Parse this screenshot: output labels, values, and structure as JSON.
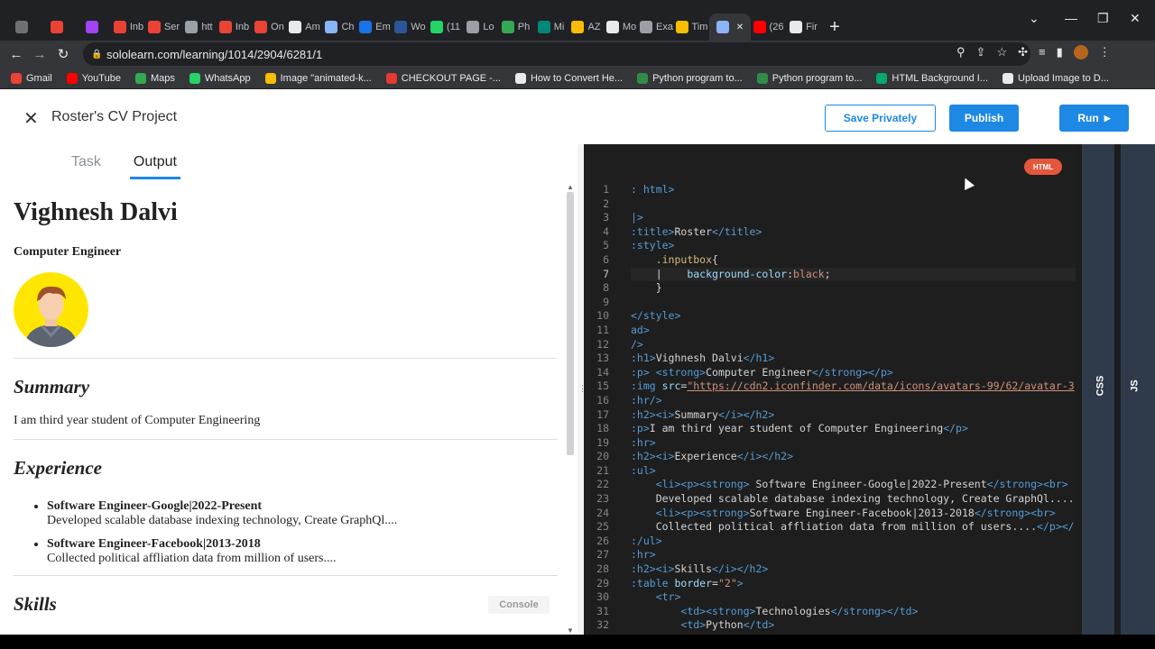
{
  "browser": {
    "tabs": [
      {
        "label": "",
        "color": "#6e7074"
      },
      {
        "label": "",
        "color": "#ea4335"
      },
      {
        "label": "",
        "color": "#a142f4"
      },
      {
        "label": "Inb",
        "color": "#ea4335"
      },
      {
        "label": "Ser",
        "color": "#ea4335"
      },
      {
        "label": "htt",
        "color": "#9aa0a6"
      },
      {
        "label": "Inb",
        "color": "#ea4335"
      },
      {
        "label": "On",
        "color": "#ea4335"
      },
      {
        "label": "Am",
        "color": "#e8eaed"
      },
      {
        "label": "Ch",
        "color": "#8ab4f8"
      },
      {
        "label": "Em",
        "color": "#1a73e8"
      },
      {
        "label": "Wo",
        "color": "#2b579a"
      },
      {
        "label": "(11",
        "color": "#25d366"
      },
      {
        "label": "Lo",
        "color": "#9aa0a6"
      },
      {
        "label": "Ph",
        "color": "#34a853"
      },
      {
        "label": "Mi",
        "color": "#00897b"
      },
      {
        "label": "AZ",
        "color": "#fbbc04"
      },
      {
        "label": "Mo",
        "color": "#e8eaed"
      },
      {
        "label": "Exa",
        "color": "#9aa0a6"
      },
      {
        "label": "Tim",
        "color": "#fbbc04"
      },
      {
        "label": "",
        "color": "#8ab4f8",
        "active": true
      },
      {
        "label": "(26",
        "color": "#ff0000"
      },
      {
        "label": "Fir",
        "color": "#e8eaed"
      }
    ],
    "url": "sololearn.com/learning/1014/2904/6281/1",
    "bookmarks": [
      {
        "label": "Gmail",
        "color": "#ea4335"
      },
      {
        "label": "YouTube",
        "color": "#ff0000"
      },
      {
        "label": "Maps",
        "color": "#34a853"
      },
      {
        "label": "WhatsApp",
        "color": "#25d366"
      },
      {
        "label": "Image \"animated-k...",
        "color": "#fbbc04"
      },
      {
        "label": "CHECKOUT PAGE -...",
        "color": "#e53935"
      },
      {
        "label": "How to Convert He...",
        "color": "#e8eaed"
      },
      {
        "label": "Python program to...",
        "color": "#2f8d46"
      },
      {
        "label": "Python program to...",
        "color": "#2f8d46"
      },
      {
        "label": "HTML Background I...",
        "color": "#04aa6d"
      },
      {
        "label": "Upload Image to D...",
        "color": "#e8eaed"
      }
    ]
  },
  "header": {
    "title": "Roster's CV Project",
    "save_label": "Save Privately",
    "publish_label": "Publish",
    "run_label": "Run"
  },
  "tabs": {
    "task": "Task",
    "output": "Output"
  },
  "output": {
    "name": "Vighnesh Dalvi",
    "role": "Computer Engineer",
    "summary_heading": "Summary",
    "summary_text": "I am third year student of Computer Engineering",
    "experience_heading": "Experience",
    "experience": [
      {
        "title": "Software Engineer-Google|2022-Present",
        "desc": "Developed scalable database indexing technology, Create GraphQl...."
      },
      {
        "title": "Software Engineer-Facebook|2013-2018",
        "desc": "Collected political affliation data from million of users...."
      }
    ],
    "skills_heading": "Skills",
    "console_label": "Console"
  },
  "editor": {
    "badge": "HTML",
    "current_line": 7,
    "lines": [
      "<span class=t>: html></span>",
      "",
      "<span class=t>|></span>",
      "<span class=t>:title></span>Roster<span class=t></title></span>",
      "<span class=t>:style></span>",
      "    <span class=c>.inputbox</span>{",
      "    |    <span class=a>background-color</span>:<span class=v>black</span>;",
      "    }",
      "",
      "<span class=t></style></span>",
      "<span class=t>ad></span>",
      "<span class=t>/></span>",
      "<span class=t>:h1></span>Vighnesh Dalvi<span class=t></h1></span>",
      "<span class=t>:p></span> <span class=t><strong></span>Computer Engineer<span class=t></strong></p></span>",
      "<span class=t>:img</span> <span class=a>src</span>=<span class=s>\"https://cdn2.iconfinder.com/data/icons/avatars-99/62/avatar-3</span>",
      "<span class=t>:hr/></span>",
      "<span class=t>:h2><i></span>Summary<span class=t></i></h2></span>",
      "<span class=t>:p></span>I am third year student of Computer Engineering<span class=t></p></span>",
      "<span class=t>:hr></span>",
      "<span class=t>:h2><i></span>Experience<span class=t></i></h2></span>",
      "<span class=t>:ul></span>",
      "    <span class=t><li><p><strong></span> Software Engineer-Google|2022-Present<span class=t></strong><br></span>",
      "    Developed scalable database indexing technology, Create GraphQl....",
      "    <span class=t><li><p><strong></span>Software Engineer-Facebook|2013-2018<span class=t></strong><br></span>",
      "    Collected political affliation data from million of users....<span class=t></p></</span>",
      "<span class=t>:/ul></span>",
      "<span class=t>:hr></span>",
      "<span class=t>:h2><i></span>Skills<span class=t></i></h2></span>",
      "<span class=t>:table</span> <span class=a>border</span>=<span class=v>\"2\"</span><span class=t>></span>",
      "    <span class=t><tr></span>",
      "        <span class=t><td><strong></span>Technologies<span class=t></strong></td></span>",
      "        <span class=t><td></span>Python<span class=t></td></span>"
    ]
  },
  "side_panels": {
    "css": "CSS",
    "js": "JS"
  }
}
